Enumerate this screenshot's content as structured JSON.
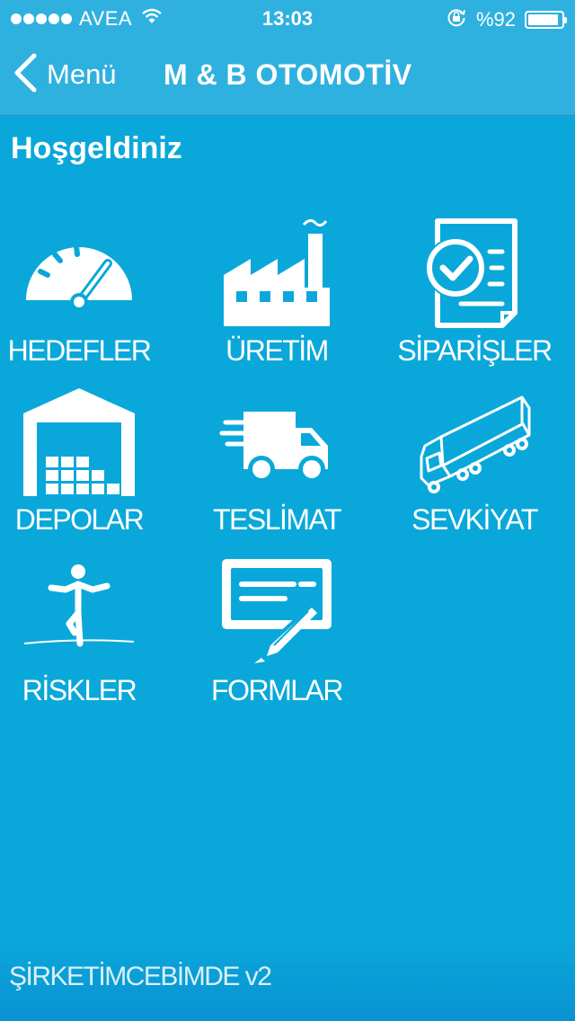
{
  "status_bar": {
    "carrier": "AVEA",
    "time": "13:03",
    "battery": "%92",
    "battery_level": 0.92,
    "icons": [
      "signal-dots-icon",
      "wifi-icon",
      "rotation-lock-icon",
      "battery-icon"
    ]
  },
  "nav": {
    "back_label": "Menü",
    "title": "M & B OTOMOTİV"
  },
  "page": {
    "title": "Hoşgeldiniz"
  },
  "menu": [
    {
      "label": "HEDEFLER",
      "icon": "speedometer-icon"
    },
    {
      "label": "ÜRETİM",
      "icon": "factory-icon"
    },
    {
      "label": "SİPARİŞLER",
      "icon": "order-document-icon"
    },
    {
      "label": "DEPOLAR",
      "icon": "warehouse-icon"
    },
    {
      "label": "TESLİMAT",
      "icon": "delivery-van-icon"
    },
    {
      "label": "SEVKİYAT",
      "icon": "truck-icon"
    },
    {
      "label": "RİSKLER",
      "icon": "tightrope-walker-icon"
    },
    {
      "label": "FORMLAR",
      "icon": "form-pen-icon"
    }
  ],
  "footer": {
    "text": "ŞİRKETİMCEBİMDE v2"
  },
  "colors": {
    "background": "#0aa8da",
    "header": "#2fb1e0",
    "text": "#ffffff"
  }
}
